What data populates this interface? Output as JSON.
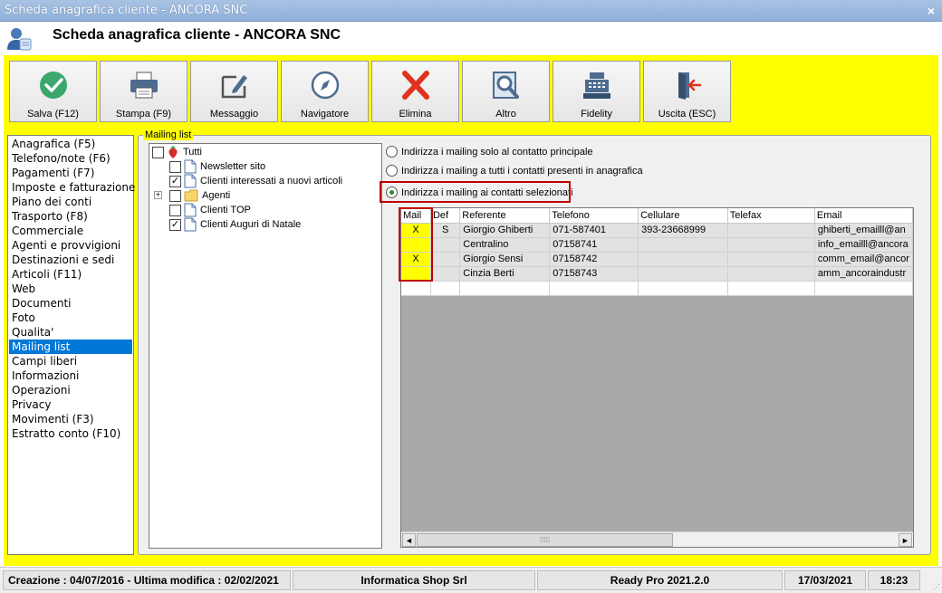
{
  "window": {
    "title": "Scheda anagrafica cliente - ANCORA SNC",
    "header_title": "Scheda anagrafica cliente - ANCORA SNC",
    "close_symbol": "×"
  },
  "toolbar": [
    {
      "label": "Salva (F12)",
      "icon": "check-icon"
    },
    {
      "label": "Stampa (F9)",
      "icon": "printer-icon"
    },
    {
      "label": "Messaggio",
      "icon": "message-icon"
    },
    {
      "label": "Navigatore",
      "icon": "compass-icon"
    },
    {
      "label": "Elimina",
      "icon": "delete-x-icon"
    },
    {
      "label": "Altro",
      "icon": "search-document-icon"
    },
    {
      "label": "Fidelity",
      "icon": "cash-register-icon"
    },
    {
      "label": "Uscita (ESC)",
      "icon": "exit-door-icon"
    }
  ],
  "nav": {
    "items": [
      "Anagrafica (F5)",
      "Telefono/note (F6)",
      "Pagamenti (F7)",
      "Imposte e fatturazione",
      "Piano dei conti",
      "Trasporto (F8)",
      "Commerciale",
      "Agenti e provvigioni",
      "Destinazioni e sedi",
      "Articoli (F11)",
      "Web",
      "Documenti",
      "Foto",
      "Qualita'",
      "Mailing list",
      "Campi liberi",
      "Informazioni",
      "Operazioni",
      "Privacy",
      "Movimenti (F3)",
      "Estratto conto (F10)"
    ],
    "selected": "Mailing list"
  },
  "mailing": {
    "group_label": "Mailing list",
    "tree": {
      "root": "Tutti",
      "children": [
        {
          "label": "Newsletter sito",
          "checked": false,
          "type": "document"
        },
        {
          "label": "Clienti interessati a nuovi articoli",
          "checked": true,
          "type": "document"
        },
        {
          "label": "Agenti",
          "checked": false,
          "type": "folder",
          "expander": "+"
        },
        {
          "label": "Clienti TOP",
          "checked": false,
          "type": "document"
        },
        {
          "label": "Clienti Auguri di Natale",
          "checked": true,
          "type": "document"
        }
      ],
      "check_mark": "✓"
    },
    "options": [
      {
        "label": "Indirizza i mailing solo al contatto principale",
        "selected": false
      },
      {
        "label": "Indirizza i mailing a tutti i contatti presenti in anagrafica",
        "selected": false
      },
      {
        "label": "Indirizza i mailing ai contatti selezionati",
        "selected": true
      }
    ],
    "grid": {
      "columns": [
        "Mail",
        "Def",
        "Referente",
        "Telefono",
        "Cellulare",
        "Telefax",
        "Email"
      ],
      "rows": [
        [
          "X",
          "S",
          "Giorgio Ghiberti",
          "071-587401",
          "393-23668999",
          "",
          "ghiberti_emailll@an"
        ],
        [
          "",
          "",
          "Centralino",
          "07158741",
          "",
          "",
          "info_emailll@ancora"
        ],
        [
          "X",
          "",
          "Giorgio Sensi",
          "07158742",
          "",
          "",
          "comm_email@ancor"
        ],
        [
          "",
          "",
          "Cinzia Berti",
          "07158743",
          "",
          "",
          "amm_ancoraindustr"
        ]
      ],
      "scroll_left": "◄",
      "scroll_right": "►",
      "thumb_grip": "⁞⁞⁞⁞⁞"
    }
  },
  "status": {
    "dates": "Creazione : 04/07/2016 - Ultima modifica : 02/02/2021",
    "company": "Informatica Shop Srl",
    "version": "Ready Pro 2021.2.0",
    "date": "17/03/2021",
    "time": "18:23",
    "grip": "⋰"
  },
  "colors": {
    "accent": "#0078d7",
    "highlight": "#ffff00",
    "annotation": "#c00000"
  }
}
